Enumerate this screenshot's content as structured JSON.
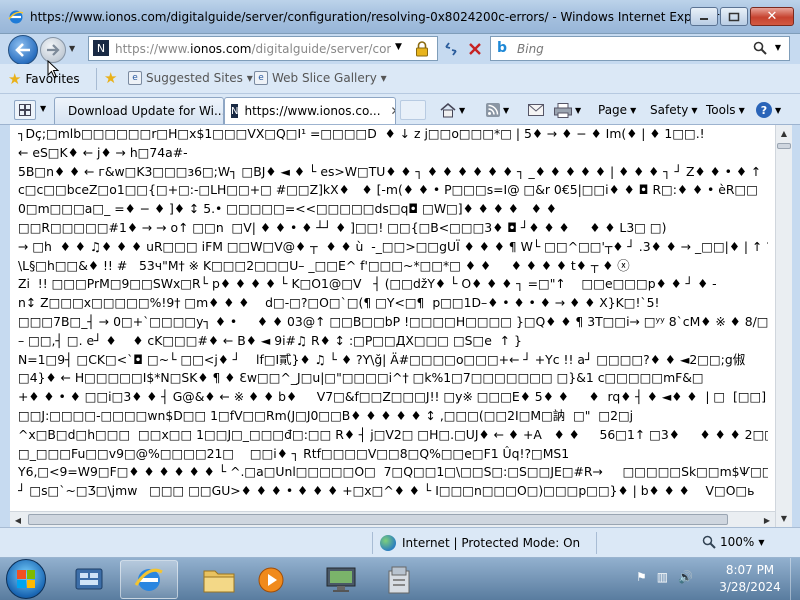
{
  "window": {
    "title": "https://www.ionos.com/digitalguide/server/configuration/resolving-0x8024200c-errors/ - Windows Internet Explorer",
    "close_label": "✕"
  },
  "address_bar": {
    "url_prefix": "https://www.",
    "url_domain": "ionos.com",
    "url_rest": "/digitalguide/server/configu",
    "site_icon": "N"
  },
  "search": {
    "placeholder": "Bing",
    "provider_icon": "bing-icon"
  },
  "favorites_bar": {
    "favorites_label": "Favorites",
    "items": [
      {
        "label": "Suggested Sites ▾",
        "icon": "suggested-sites-icon"
      },
      {
        "label": "Web Slice Gallery ▾",
        "icon": "web-slice-icon"
      }
    ]
  },
  "tabs": [
    {
      "label": "Download Update for Wi...",
      "icon": "microsoft-icon",
      "active": false
    },
    {
      "label": "https://www.ionos.co...",
      "icon": "ionos-icon",
      "active": true
    }
  ],
  "command_bar": {
    "page_label": "Page",
    "safety_label": "Safety",
    "tools_label": "Tools"
  },
  "content": {
    "lines": [
      "┐Dç;□mlb□□□□□□r□H□x$1□□□VX□Q□I¹ =□□□□D  ♦ ↓ z j□□o□□□*□ | 5♦ → ♦ − ♦ Im(♦ | ♦ 1□□.!",
      "← eS□K♦ ← j♦ → h□74a#-",
      "5B□n♦ ♦ ← г&w□K3□□□з6□;W┐ □BJ♦ ◄ ♦ └ es>W□TU♦ ♦ ┐ ♦ ♦ ♦ ♦ ♦ ♦ ┐ _♦ ♦ ♦ ♦ ♦ | ♦ ♦ ♦ ┐ ┘ Z♦ ♦ • ♦ ↑",
      "c□c□□bceZ□o1□□{□+□:-□LH□□+□ #□□Z]kX♦   ♦ [-m(♦ ♦ • P□□□s=I@ □&r 0€5|□□i♦ ♦ ◘ R□:♦ ♦ • èR□□",
      "0□m□□□a□_ =♦ − ♦ ]♦ ↕ 5.• □□□□□=<<□□□□□ds□q◘ □W□]♦ ♦ ♦ ♦   ♦ ♦",
      "□□R□□□□□#1♦ → → o↑ □□n  □V| ♦ ♦ • ♦ ┴┘ ♦ ]□□! □□{□B<□□□3♦ ◘ ┘♦ ♦ ♦     ♦ ♦ L3□ □)",
      "→ □h  ♦ ♦ ♫♦ ♦ ♦ uR□□□ iFM □□W□V@♦ ┬  ♦ ♦ ù  -_□□>□□gUÏ ♦ ♦ ♦ ¶ W└ □□^□□'┬♦ ┘ .3♦ ♦ → _□□|♦ | ↑ ?",
      "\\L§□h□□&♦ !! #   53ч\"M† ※ K□□□2□□□U– _□□E^ f'□□□~*□□*□ ♦ ♦     ♦ ♦ ♦ ♦ t♦ ┬ ♦ ⓧ",
      "Zi  !! □□□PrM□9□□SWx□R└ p♦ ♦ ♦ ♦ └ K□O1@□V   ┤ (□□džY♦ └ O♦ ♦ ♦ ┐ =□\"↑    □□e□□□p♦ ♦ ┘ ♦ -",
      "n↕ Z□□□x□□□□□%!9† □m♦ ♦ ♦    d□-□?□O□`□(¶ □Y<□¶  p□□1D–♦ • ♦ • ♦ → ♦ ♦ X}K□!`5!",
      "□□□7B□_┤ → 0□+`□□□□y┐ ♦ •     ♦ ♦ 03@↑ □□B□□bP !□□□□H□□□□ }□Q♦ ♦ ¶ 3T□□i→ □ʸʸ 8`cM♦ ※ ♦ 8/□ ?",
      "– □□,┤ □. e┘ ♦    ♦ cK□□□#♦ ← B♦ ◄ 9i#♫ R♦ ↕ :□P□□ДX□□□ □S□e  ↑ }",
      "N=1□9┤ □CK□<`◘ □~└ □□<j♦ ┘    lf□I貳}♦ ♫ └ ♦ ?Y\\ğ| Ä#□□□□o□□□+← ┘ +Yc !! a┘ □□□□?♦ ♦ ◄2□□;g俶",
      "□4}♦ ← H□□□□□I$*N□SK♦ ¶ ♦ Ɛw□□^_J□u|□\"□□□□i^† □k%1□7□□□□□□□ □}&1 с□□□□□mF&□",
      "+♦ ♦ • ♦ □□i□3♦ ♦ ┤ G@&♦ ← ※ ♦ ♦ b♦     V7□&f□□Z□□□J!! □y※ □□□E♦ 5♦ ♦     ♦  rq♦ ┤ ♦ ◄♦ ♦  | □  [□□]",
      "□□J:□□□□-□□□□wn$D□□ 1□fV□□Rm(J□J0□□B♦ ♦ ♦ ♦ ♦ ↕ ,□□□(□□2I□M□訥  □\"  □2□j",
      "^x□B□d□h□□□  □□x□□ 1□□J□_□□□đ□:□□ R♦ ┤ j□V2□ □H□.□UJ♦ ← ♦ +A   ♦ ♦     56□1↑ □3♦     ♦ ♦ ♦ 2□□□□",
      "□_□□□Fu□□v9□@%□□□□21□    □□i♦ ┐ Rtf□□□□V□□8□Q%□□e□F1 Ûq!?□MS1",
      "Y6,□<9=W9□F□♦ ♦ ♦ ♦ ♦ ♦ └ ^.□a□Unl□□□□□O□  7□Q□□1□\\□□S□:□S□□JE□#R→     □□□□□Sk□□m$Ѱ□□□%",
      "┘ □s□`~□Ʒ□\\jmw   □□□ □□GU>♦ ♦ ♦ • ♦ ♦ ♦ +□x□^♦ ♦ └ I□□□n□□□O□)□□□p□□}♦ | b♦ ♦ ♦    V□O□ь"
    ]
  },
  "status_bar": {
    "zone_text": "Internet | Protected Mode: On",
    "zoom_text": "100%"
  },
  "taskbar": {
    "time": "8:07 PM",
    "date": "3/28/2024"
  }
}
